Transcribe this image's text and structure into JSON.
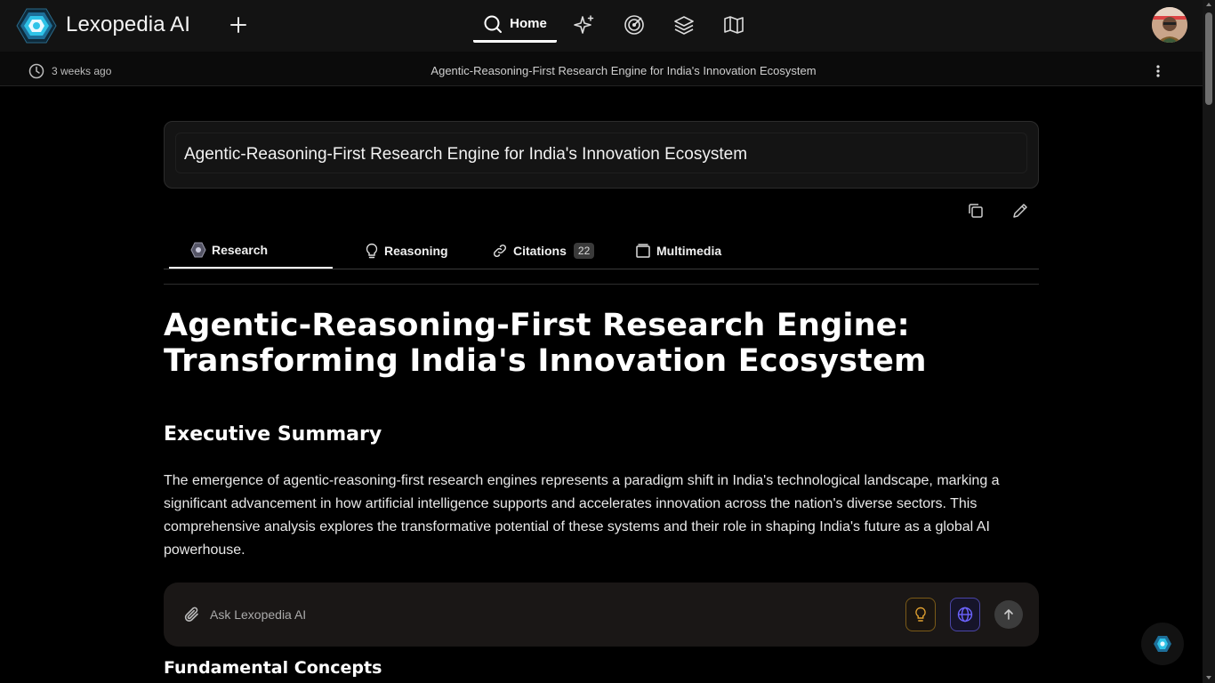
{
  "app": {
    "name": "Lexopedia AI"
  },
  "nav": {
    "home_label": "Home",
    "icons": [
      "sparkles-icon",
      "radar-icon",
      "layers-icon",
      "map-icon"
    ]
  },
  "subheader": {
    "time_ago": "3 weeks ago",
    "title": "Agentic-Reasoning-First Research Engine for India's Innovation Ecosystem"
  },
  "query": {
    "text": "Agentic-Reasoning-First Research Engine for India's Innovation Ecosystem"
  },
  "tabs": [
    {
      "label": "Research",
      "icon": "lexopedia-icon",
      "active": true
    },
    {
      "label": "Reasoning",
      "icon": "lightbulb-icon",
      "active": false
    },
    {
      "label": "Citations",
      "icon": "link-icon",
      "count": "22",
      "active": false
    },
    {
      "label": "Multimedia",
      "icon": "media-icon",
      "active": false
    }
  ],
  "article": {
    "title_line1": "Agentic-Reasoning-First Research Engine:",
    "title_line2": "Transforming India's Innovation Ecosystem",
    "section1_heading": "Executive Summary",
    "section1_body": "The emergence of agentic-reasoning-first research engines represents a paradigm shift in India's technological landscape, marking a significant advancement in how artificial intelligence supports and accelerates innovation across the nation's diverse sectors. This comprehensive analysis explores the transformative potential of these systems and their role in shaping India's future as a global AI powerhouse.",
    "section2_heading": "Fundamental Concepts"
  },
  "ask": {
    "placeholder": "Ask Lexopedia AI"
  },
  "colors": {
    "background": "#000000",
    "topbar": "#131313",
    "accent_idea": "#e0a030",
    "accent_web": "#6c63ff",
    "logo_cyan": "#2fc3e8"
  }
}
